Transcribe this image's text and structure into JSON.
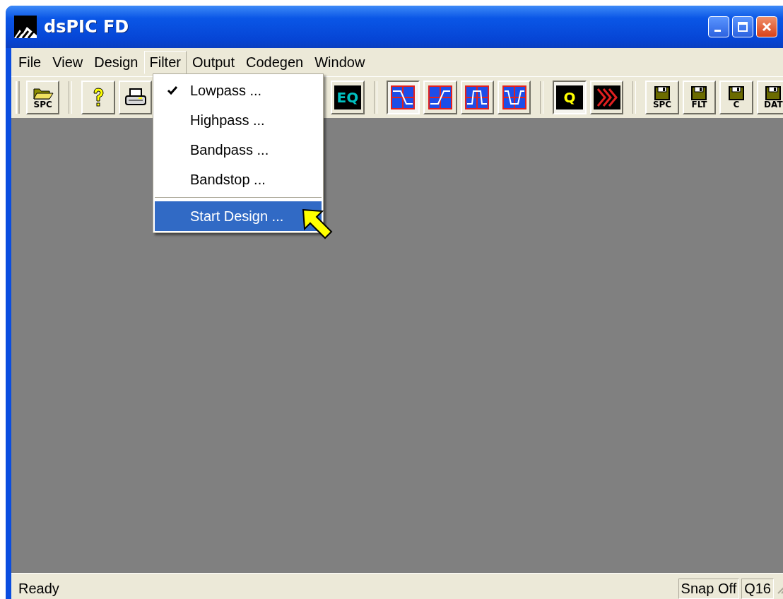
{
  "window": {
    "title": "dsPIC FD"
  },
  "menu_bar": [
    {
      "label": "File",
      "selected": false
    },
    {
      "label": "View",
      "selected": false
    },
    {
      "label": "Design",
      "selected": false
    },
    {
      "label": "Filter",
      "selected": true
    },
    {
      "label": "Output",
      "selected": false
    },
    {
      "label": "Codegen",
      "selected": false
    },
    {
      "label": "Window",
      "selected": false
    }
  ],
  "toolbar": [
    {
      "kind": "open",
      "label": "SPC",
      "selected": false
    },
    {
      "kind": "separator"
    },
    {
      "kind": "help",
      "selected": false
    },
    {
      "kind": "print",
      "selected": false
    },
    {
      "kind": "hidden"
    },
    {
      "kind": "eq",
      "label": "EQ",
      "selected": false
    },
    {
      "kind": "separator"
    },
    {
      "kind": "lowpass",
      "selected": true
    },
    {
      "kind": "highpass",
      "selected": false
    },
    {
      "kind": "bandpass",
      "selected": false
    },
    {
      "kind": "bandstop",
      "selected": false
    },
    {
      "kind": "separator"
    },
    {
      "kind": "q",
      "label": "Q",
      "selected": true
    },
    {
      "kind": "run",
      "selected": false
    },
    {
      "kind": "separator"
    },
    {
      "kind": "save",
      "label": "SPC",
      "selected": false
    },
    {
      "kind": "save",
      "label": "FLT",
      "selected": false
    },
    {
      "kind": "save",
      "label": "C",
      "selected": false
    },
    {
      "kind": "save",
      "label": "DAT",
      "selected": false
    }
  ],
  "filter_menu": [
    {
      "kind": "item",
      "label": "Lowpass ...",
      "checked": true,
      "selected": false
    },
    {
      "kind": "item",
      "label": "Highpass ...",
      "checked": false,
      "selected": false
    },
    {
      "kind": "item",
      "label": "Bandpass ...",
      "checked": false,
      "selected": false
    },
    {
      "kind": "item",
      "label": "Bandstop ...",
      "checked": false,
      "selected": false
    },
    {
      "kind": "separator"
    },
    {
      "kind": "item",
      "label": "Start Design ...",
      "checked": false,
      "selected": true
    }
  ],
  "status_bar": {
    "message": "Ready",
    "panels": [
      "Snap Off",
      "Q16"
    ]
  }
}
